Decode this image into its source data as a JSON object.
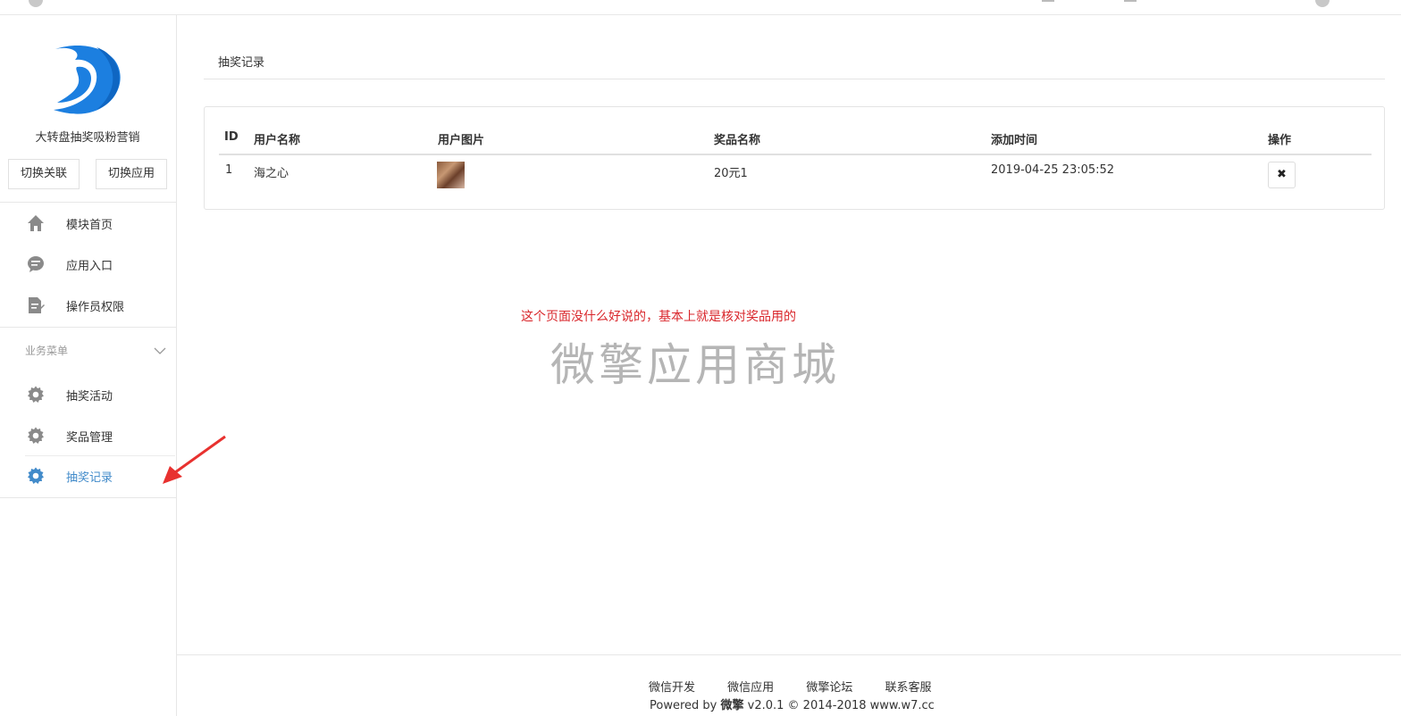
{
  "sidebar": {
    "app_name": "大转盘抽奖吸粉营销",
    "switch_link_label": "切换关联",
    "switch_app_label": "切换应用",
    "nav_top": [
      {
        "label": "模块首页",
        "icon": "home-icon"
      },
      {
        "label": "应用入口",
        "icon": "chat-bubble-icon"
      },
      {
        "label": "操作员权限",
        "icon": "document-edit-icon"
      }
    ],
    "section_title": "业务菜单",
    "nav_business": [
      {
        "label": "抽奖活动",
        "icon": "gear-icon"
      },
      {
        "label": "奖品管理",
        "icon": "gear-icon"
      },
      {
        "label": "抽奖记录",
        "icon": "gear-icon",
        "active": true
      }
    ],
    "active_color": "#428bca"
  },
  "main": {
    "tab_label": "抽奖记录",
    "table": {
      "headers": [
        "ID",
        "用户名称",
        "用户图片",
        "奖品名称",
        "添加时间",
        "操作"
      ],
      "rows": [
        {
          "id": "1",
          "username": "海之心",
          "prize": "20元1",
          "time": "2019-04-25 23:05:52",
          "action_icon": "close-icon"
        }
      ]
    },
    "delete_glyph": "✖",
    "note": "这个页面没什么好说的，基本上就是核对奖品用的",
    "watermark": "微擎应用商城"
  },
  "footer": {
    "links": [
      "微信开发",
      "微信应用",
      "微擎论坛",
      "联系客服"
    ],
    "powered_prefix": "Powered by ",
    "powered_brand": "微擎",
    "powered_suffix": " v2.0.1 © 2014-2018 www.w7.cc"
  },
  "colors": {
    "logo_blue": "#1c7fe0",
    "note_red": "#d9262b",
    "watermark_gray": "#b5b5b5"
  }
}
